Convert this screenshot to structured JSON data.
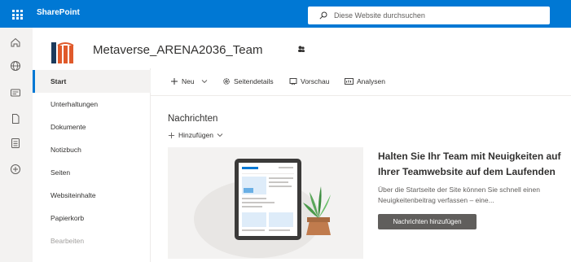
{
  "suitebar": {
    "app_name": "SharePoint",
    "search_placeholder": "Diese Website durchsuchen",
    "accent": "#0078d4"
  },
  "rail": {
    "icons": [
      "home-icon",
      "globe-icon",
      "news-icon",
      "file-icon",
      "list-icon",
      "add-circle-icon"
    ]
  },
  "header": {
    "site_title": "Metaverse_ARENA2036_Team"
  },
  "leftnav": {
    "items": [
      {
        "label": "Start"
      },
      {
        "label": "Unterhaltungen"
      },
      {
        "label": "Dokumente"
      },
      {
        "label": "Notizbuch"
      },
      {
        "label": "Seiten"
      },
      {
        "label": "Websiteinhalte"
      },
      {
        "label": "Papierkorb"
      },
      {
        "label": "Bearbeiten"
      }
    ]
  },
  "cmdbar": {
    "new_label": "Neu",
    "details_label": "Seitendetails",
    "preview_label": "Vorschau",
    "analytics_label": "Analysen"
  },
  "news": {
    "title": "Nachrichten",
    "add_label": "Hinzufügen",
    "promo_title": "Halten Sie Ihr Team mit Neuigkeiten auf Ihrer Teamwebsite auf dem Laufenden",
    "promo_text": "Über die Startseite der Site können Sie schnell einen Neuigkeitenbeitrag verfassen – eine...",
    "promo_button": "Nachrichten hinzufügen"
  }
}
